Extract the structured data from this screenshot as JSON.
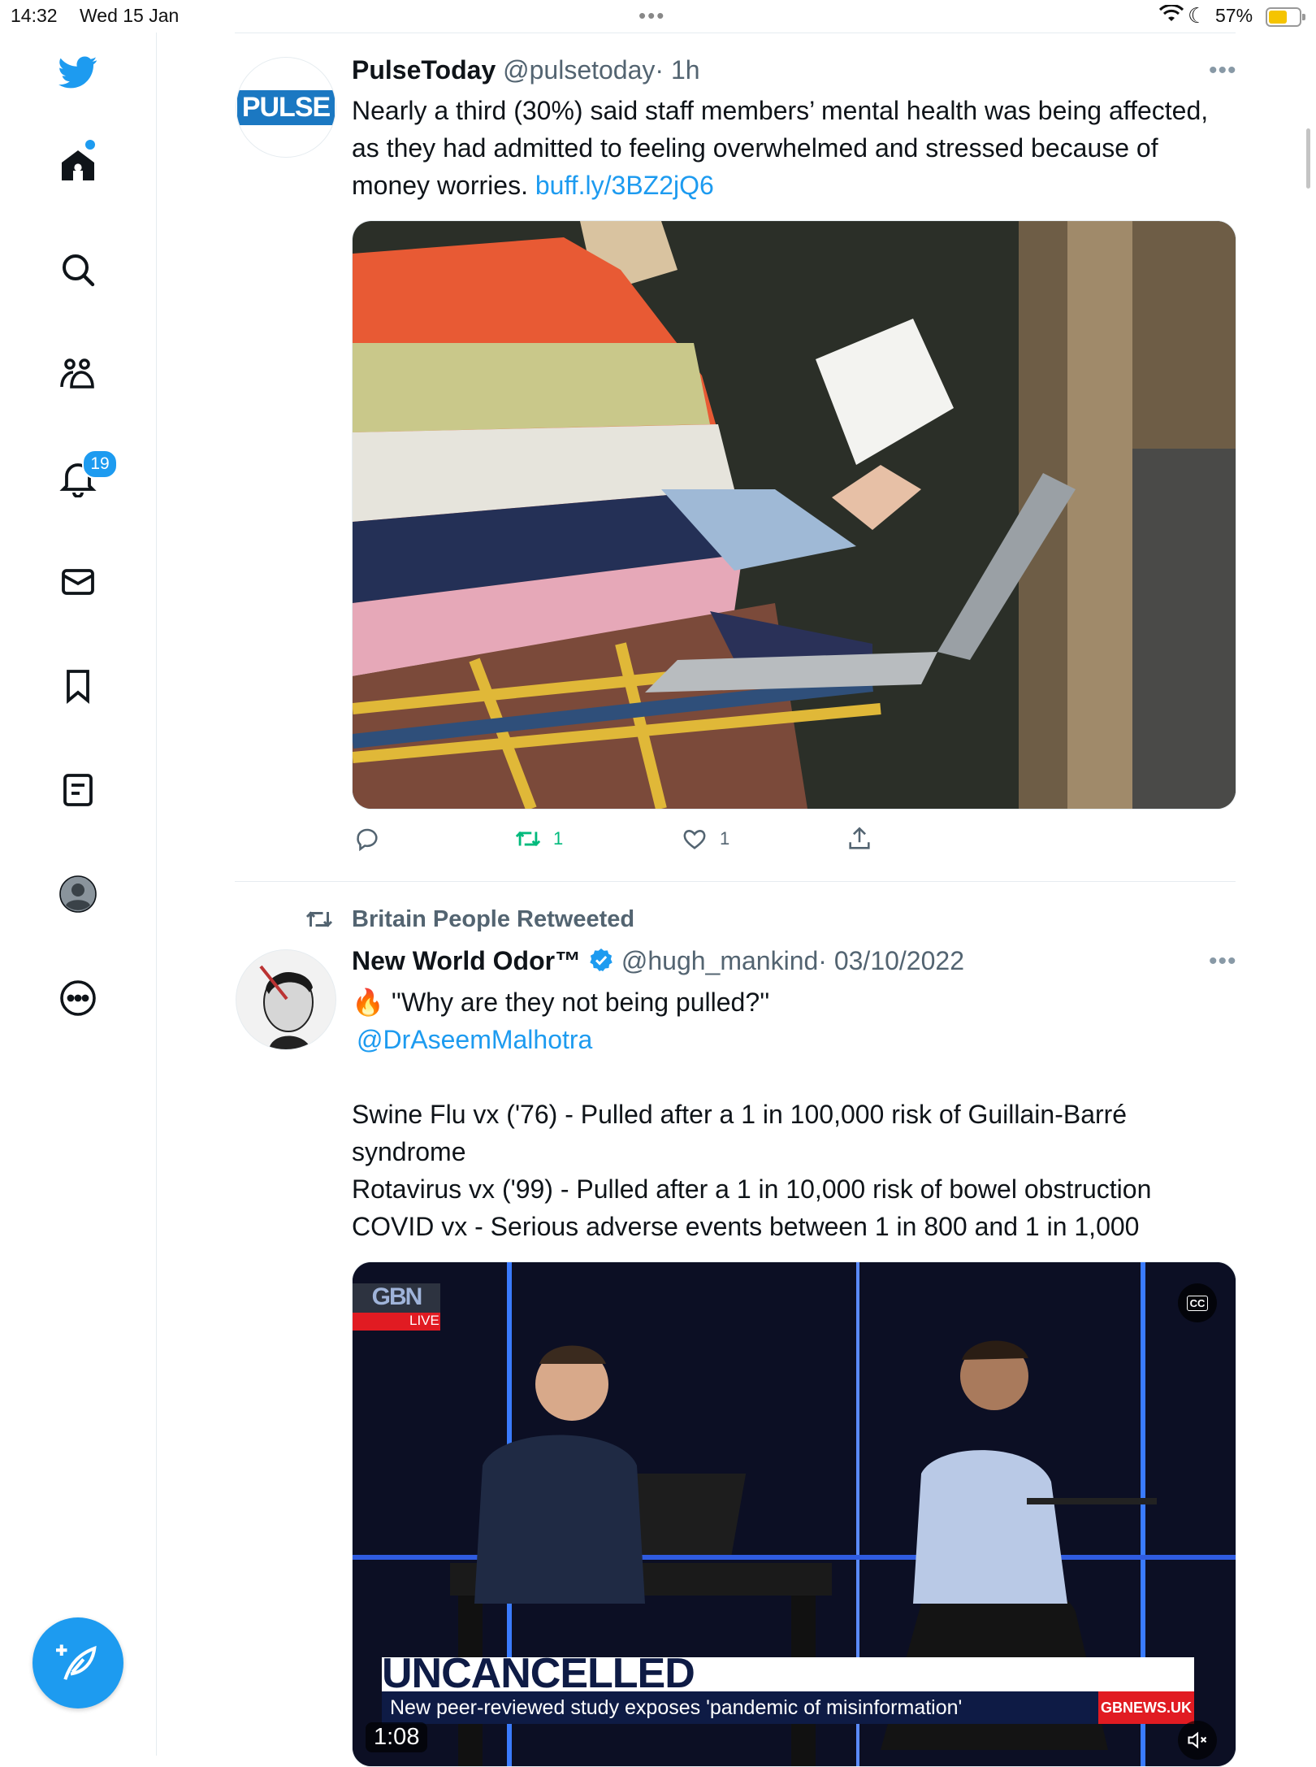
{
  "status_bar": {
    "time": "14:32",
    "date": "Wed 15 Jan",
    "battery": "57%"
  },
  "sidebar": {
    "notification_count": "19",
    "items": [
      "home-icon",
      "search-icon",
      "communities-icon",
      "notifications-icon",
      "messages-icon",
      "bookmarks-icon",
      "lists-icon",
      "profile-icon",
      "more-icon"
    ]
  },
  "tweets": [
    {
      "name": "PulseToday",
      "handle": "@pulsetoday",
      "time": "· 1h",
      "avatar_text": "PULSE",
      "text": "Nearly a third (30%) said staff members’ mental health was being affected, as they had admitted to feeling overwhelmed and stressed because of money worries. ",
      "link": "buff.ly/3BZ2jQ6",
      "retweets": "1",
      "likes": "1"
    },
    {
      "retweeted_by": "Britain People Retweeted",
      "name": "New World Odor™",
      "handle": "@hugh_mankind",
      "time": "· 03/10/2022",
      "line1": "🔥 ''Why are they not being pulled?''",
      "mention": "@DrAseemMalhotra",
      "body_lines": [
        "Swine Flu vx ('76) - Pulled after a 1 in 100,000 risk of Guillain-Barré",
        "syndrome",
        "Rotavirus vx ('99) - Pulled after a 1 in 10,000 risk of bowel obstruction",
        "COVID vx -  Serious adverse events between 1 in 800 and 1 in 1,000"
      ],
      "video": {
        "channel": "GBN",
        "live": "LIVE",
        "headline": "UNCANCELLED",
        "ticker": "New peer-reviewed study exposes 'pandemic of misinformation'",
        "site": "GBNEWS.UK",
        "duration": "1:08",
        "cc": "CC"
      }
    }
  ]
}
